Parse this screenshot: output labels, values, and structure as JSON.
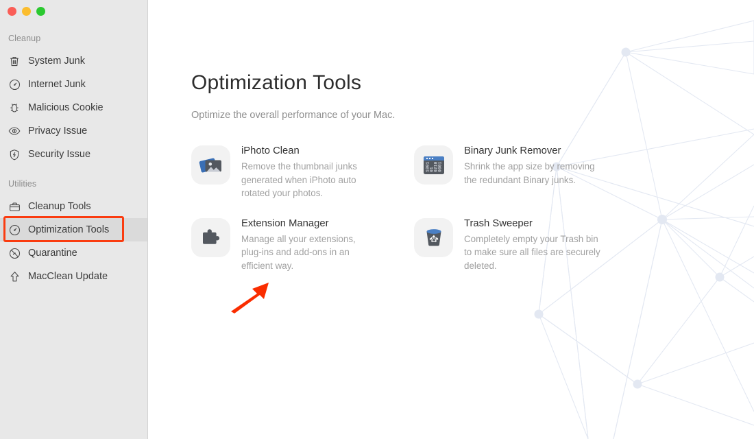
{
  "window": {
    "traffic_lights": [
      {
        "name": "close",
        "color": "#fa5e57"
      },
      {
        "name": "minimize",
        "color": "#fbbd2e"
      },
      {
        "name": "maximize",
        "color": "#2bc930"
      }
    ]
  },
  "sidebar": {
    "sections": [
      {
        "label": "Cleanup",
        "items": [
          {
            "label": "System Junk",
            "icon": "trash-icon",
            "selected": false
          },
          {
            "label": "Internet Junk",
            "icon": "speedometer-icon",
            "selected": false
          },
          {
            "label": "Malicious Cookie",
            "icon": "bug-icon",
            "selected": false
          },
          {
            "label": "Privacy Issue",
            "icon": "eye-icon",
            "selected": false
          },
          {
            "label": "Security Issue",
            "icon": "shield-bolt-icon",
            "selected": false
          }
        ]
      },
      {
        "label": "Utilities",
        "items": [
          {
            "label": "Cleanup Tools",
            "icon": "briefcase-icon",
            "selected": false
          },
          {
            "label": "Optimization Tools",
            "icon": "speedometer-icon",
            "selected": true
          },
          {
            "label": "Quarantine",
            "icon": "no-entry-icon",
            "selected": false
          },
          {
            "label": "MacClean Update",
            "icon": "up-arrow-icon",
            "selected": false
          }
        ]
      }
    ],
    "highlight_color": "#fa3c10",
    "selected_row_bg": "#dadada",
    "background": "#e8e8e8"
  },
  "main": {
    "title": "Optimization Tools",
    "subtitle": "Optimize the overall performance of your Mac.",
    "tools": [
      {
        "title": "iPhoto Clean",
        "description": "Remove the thumbnail junks generated when iPhoto auto rotated your photos.",
        "icon": "photo-stack-icon"
      },
      {
        "title": "Binary Junk Remover",
        "description": "Shrink the app size by removing the redundant Binary junks.",
        "icon": "binary-window-icon"
      },
      {
        "title": "Extension Manager",
        "description": "Manage all your extensions, plug-ins and add-ons in an efficient way.",
        "icon": "puzzle-piece-icon"
      },
      {
        "title": "Trash Sweeper",
        "description": "Completely empty your Trash bin to make sure all files are securely deleted.",
        "icon": "trash-bin-icon"
      }
    ]
  },
  "annotation": {
    "arrow_color": "#fa2d00",
    "points_at": "Extension Manager"
  }
}
